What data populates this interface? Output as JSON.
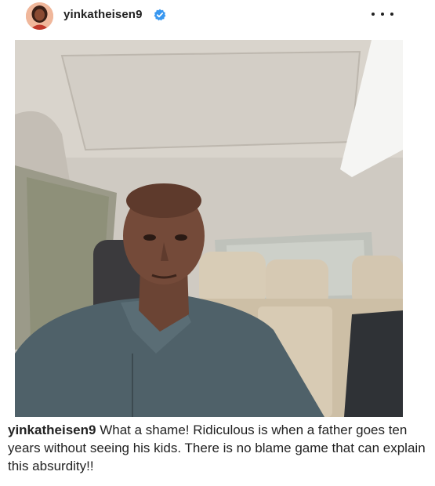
{
  "post": {
    "username": "yinkatheisen9",
    "verified": true,
    "caption_text": "What a shame! Ridiculous is when a father goes ten years without seeing his kids. There is no blame game that can explain this absurdity!!"
  },
  "icons": {
    "avatar": "profile-avatar",
    "verified": "verified-badge-icon",
    "more": "more-options-icon"
  },
  "colors": {
    "verified_blue": "#3897f0",
    "text": "#222222"
  }
}
